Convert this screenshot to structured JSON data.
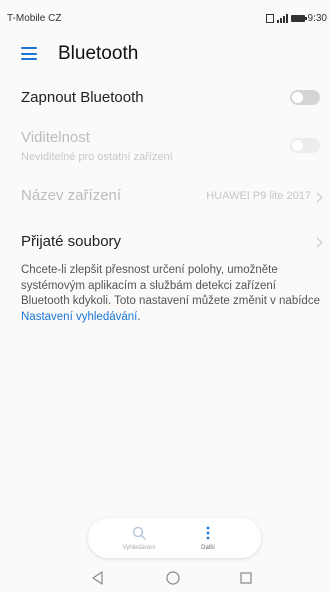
{
  "status_bar": {
    "carrier": "T-Mobile CZ",
    "time": "9:30",
    "icons": [
      "sim-icon",
      "signal-icon",
      "battery-icon"
    ]
  },
  "app_bar": {
    "menu_icon": "hamburger-menu-icon",
    "title": "Bluetooth"
  },
  "settings": {
    "bluetooth": {
      "label": "Zapnout Bluetooth",
      "enabled": false
    },
    "visibility": {
      "label": "Viditelnost",
      "sublabel": "Neviditelné pro ostatní zařízení",
      "enabled": false
    },
    "device_name": {
      "label": "Název zařízení",
      "value": "HUAWEI P9 lite 2017"
    },
    "received_files": {
      "label": "Přijaté soubory"
    }
  },
  "info": {
    "text": "Chcete-li zlepšit přesnost určení polohy, umožněte systémovým aplikacím a službám detekci zařízení Bluetooth kdykoli. Toto nastavení můžete změnit v nabídce ",
    "link": "Nastavení vyhledávání",
    "suffix": "."
  },
  "bottom_tabs": {
    "search": {
      "label": "Vyhledávání",
      "icon": "search-icon"
    },
    "more": {
      "label": "Další",
      "icon": "more-vertical-icon"
    }
  },
  "nav_bar": {
    "back_icon": "back-triangle-icon",
    "home_icon": "home-circle-icon",
    "recents_icon": "recents-square-icon"
  },
  "colors": {
    "accent": "#1a75d6",
    "toggle_off": "#d4d4d4",
    "disabled_text": "#bdbdbd"
  }
}
